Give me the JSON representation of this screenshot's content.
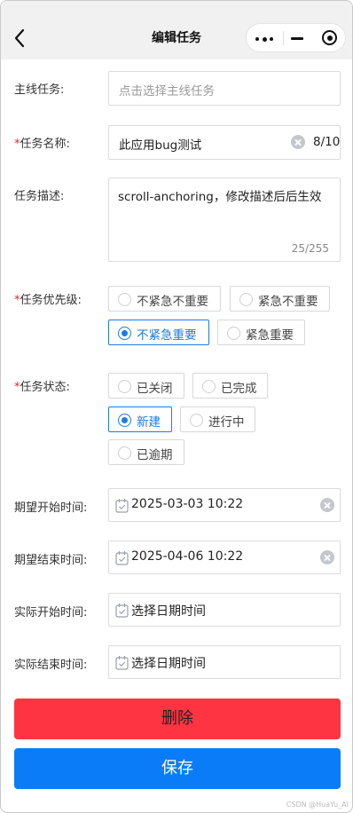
{
  "nav": {
    "title": "编辑任务"
  },
  "form": {
    "main_task": {
      "label": "主线任务:",
      "placeholder": "点击选择主线任务"
    },
    "task_name": {
      "required": "*",
      "label": "任务名称:",
      "value": "此应用bug测试",
      "count": "8/10"
    },
    "task_desc": {
      "label": "任务描述:",
      "value": "scroll-anchoring，修改描述后后生效",
      "count": "25/255"
    },
    "priority": {
      "required": "*",
      "label": "任务优先级:",
      "options": [
        "不紧急不重要",
        "紧急不重要",
        "不紧急重要",
        "紧急重要"
      ],
      "selected": "不紧急重要"
    },
    "status": {
      "required": "*",
      "label": "任务状态:",
      "options": [
        "已关闭",
        "已完成",
        "新建",
        "进行中",
        "已逾期"
      ],
      "selected": "新建"
    },
    "expected_start": {
      "label": "期望开始时间:",
      "value": "2025-03-03 10:22"
    },
    "expected_end": {
      "label": "期望结束时间:",
      "value": "2025-04-06 10:22"
    },
    "actual_start": {
      "label": "实际开始时间:",
      "placeholder": "选择日期时间"
    },
    "actual_end": {
      "label": "实际结束时间:",
      "placeholder": "选择日期时间"
    }
  },
  "buttons": {
    "delete": "删除",
    "save": "保存"
  },
  "watermark": "CSDN @HuaYu_AI",
  "colors": {
    "delete_bg": "#fe3442",
    "save_bg": "#0a7cf7",
    "selected": "#1f7ae0",
    "required": "#e02424"
  }
}
